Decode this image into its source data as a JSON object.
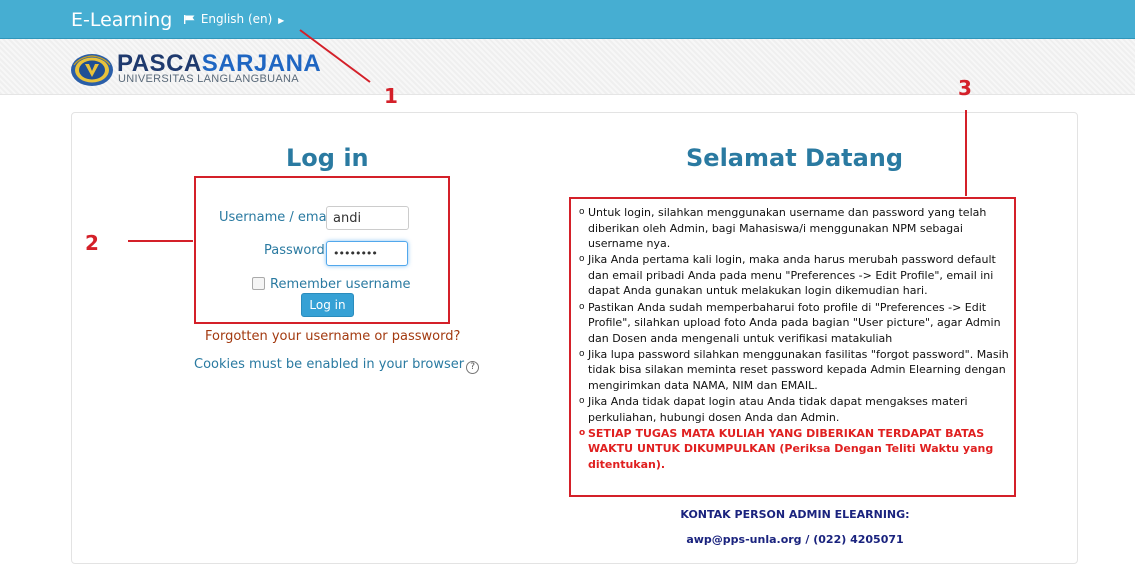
{
  "nav": {
    "brand": "E-Learning",
    "language": "English (en)"
  },
  "logo": {
    "name_part1": "PASCA",
    "name_part2": "SARJANA",
    "subtitle": "UNIVERSITAS LANGLANGBUANA"
  },
  "login": {
    "title": "Log in",
    "username_label": "Username / email",
    "username_value": "andi",
    "password_label": "Password",
    "password_value": "••••••••",
    "remember_label": "Remember username",
    "remember_checked": false,
    "button_label": "Log in",
    "forgot_link": "Forgotten your username or password?",
    "cookies_text": "Cookies must be enabled in your browser"
  },
  "welcome": {
    "title": "Selamat Datang",
    "items": [
      "Untuk login, silahkan menggunakan username dan password yang telah diberikan oleh Admin, bagi Mahasiswa/i menggunakan NPM sebagai username nya.",
      "Jika Anda pertama kali login, maka anda harus merubah password default dan email pribadi Anda pada menu \"Preferences -> Edit Profile\", email ini dapat Anda gunakan untuk melakukan login dikemudian hari.",
      "Pastikan Anda sudah memperbaharui foto profile di \"Preferences -> Edit Profile\", silahkan upload foto Anda pada bagian \"User picture\", agar Admin dan Dosen anda mengenali untuk verifikasi matakuliah",
      "Jika lupa password silahkan menggunakan fasilitas \"forgot password\". Masih tidak bisa silakan meminta reset password kepada Admin Elearning dengan mengirimkan data NAMA, NIM dan EMAIL.",
      "Jika Anda tidak dapat login atau Anda tidak dapat mengakses materi perkuliahan, hubungi dosen Anda dan Admin.",
      "SETIAP TUGAS MATA KULIAH YANG DIBERIKAN TERDAPAT BATAS WAKTU UNTUK DIKUMPULKAN (Periksa Dengan Teliti Waktu yang ditentukan)."
    ],
    "contact_title": "KONTAK PERSON ADMIN ELEARNING:",
    "contact_detail": "awp@pps-unla.org / (022) 4205071"
  },
  "annotations": {
    "one": "1",
    "two": "2",
    "three": "3"
  },
  "colors": {
    "topbar": "#46aed2",
    "heading": "#2a7aa1",
    "annotation": "#d42029",
    "warning": "#e02020",
    "button": "#36a1d5"
  },
  "icons": {
    "language_flag": "flag-icon",
    "language_caret": "caret-right-icon",
    "logo": "university-seal-icon",
    "help": "help-icon"
  }
}
